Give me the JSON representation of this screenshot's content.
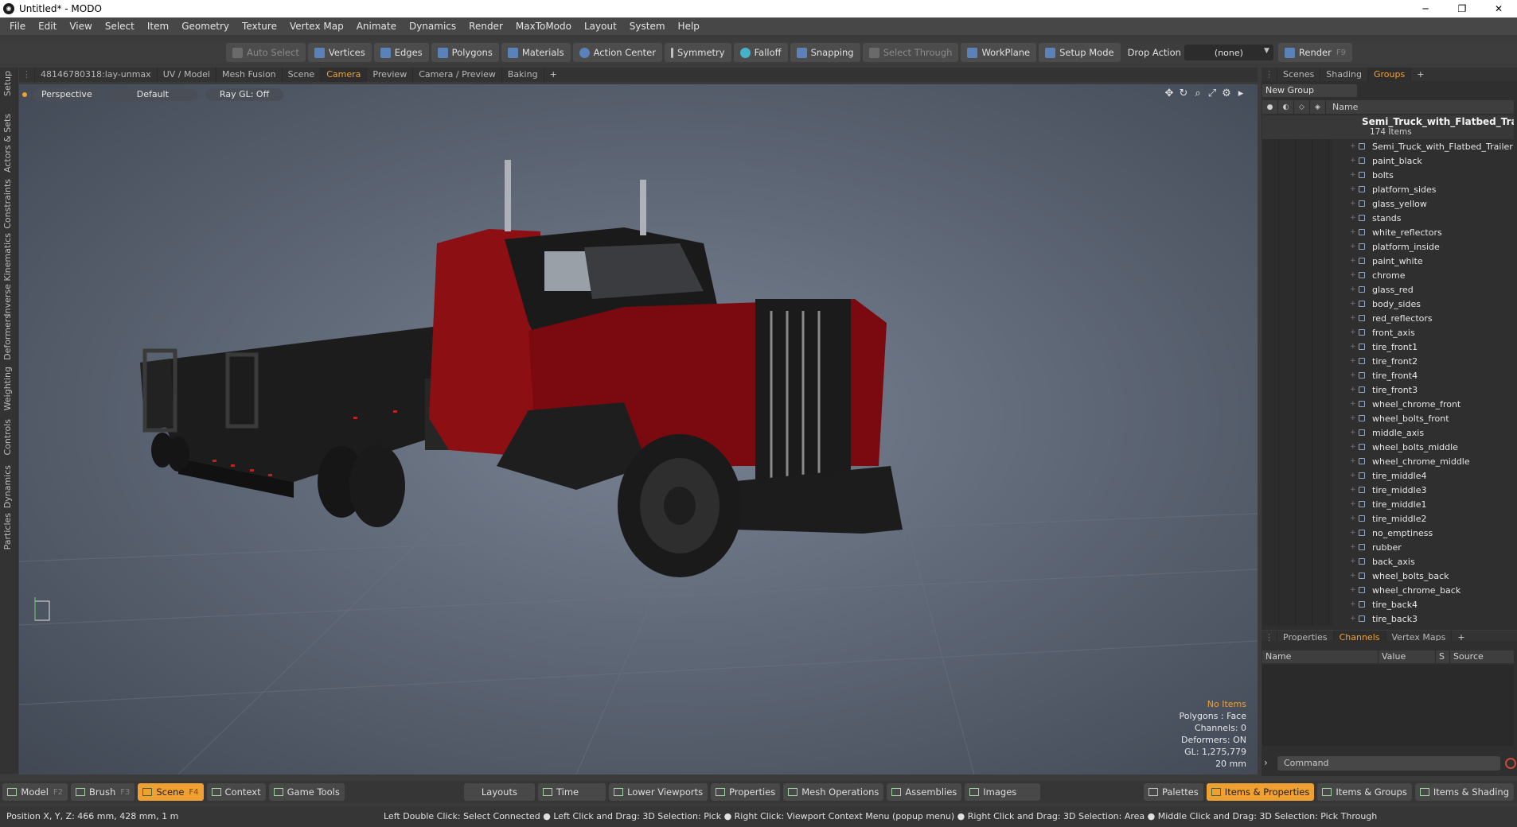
{
  "app": {
    "window_title": "Untitled* - MODO",
    "window_controls": [
      "─",
      "❐",
      "✕"
    ]
  },
  "menu": [
    "File",
    "Edit",
    "View",
    "Select",
    "Item",
    "Geometry",
    "Texture",
    "Vertex Map",
    "Animate",
    "Dynamics",
    "Render",
    "MaxToModo",
    "Layout",
    "System",
    "Help"
  ],
  "toolbar": {
    "auto_select": "Auto Select",
    "vertices": "Vertices",
    "edges": "Edges",
    "polygons": "Polygons",
    "materials": "Materials",
    "action_center": "Action Center",
    "symmetry": "Symmetry",
    "falloff": "Falloff",
    "snapping": "Snapping",
    "select_through": "Select Through",
    "workplane": "WorkPlane",
    "setup_mode": "Setup Mode",
    "drop_action_label": "Drop Action",
    "drop_action_value": "(none)",
    "render": "Render",
    "render_key": "F9"
  },
  "viewport_tabs": [
    "48146780318:lay-unmax",
    "UV / Model",
    "Mesh Fusion",
    "Scene",
    "Camera",
    "Preview",
    "Camera / Preview",
    "Baking",
    "+"
  ],
  "viewport_tabs_active": "Camera",
  "left_tabs": [
    "Setup",
    "Actors & Sets",
    "Constraints",
    "Inverse Kinematics",
    "Deformers",
    "Weighting",
    "Controls",
    "Dynamics",
    "Particles"
  ],
  "viewport": {
    "options": [
      "Perspective",
      "Default",
      "Ray GL: Off"
    ],
    "info": {
      "items": "No Items",
      "polygons": "Polygons : Face",
      "channels": "Channels: 0",
      "deformers": "Deformers: ON",
      "gl": "GL: 1,275,779",
      "scale": "20 mm"
    }
  },
  "right_tabs": [
    "Scenes",
    "Shading",
    "Groups",
    "+"
  ],
  "right_tabs_active": "Groups",
  "groups": {
    "new_group": "New Group",
    "column_name": "Name",
    "group_name": "Semi_Truck_with_Flatbed_Tra...",
    "group_count": "174 Items",
    "items": [
      "Semi_Truck_with_Flatbed_Trailer",
      "paint_black",
      "bolts",
      "platform_sides",
      "glass_yellow",
      "stands",
      "white_reflectors",
      "platform_inside",
      "paint_white",
      "chrome",
      "glass_red",
      "body_sides",
      "red_reflectors",
      "front_axis",
      "tire_front1",
      "tire_front2",
      "tire_front4",
      "tire_front3",
      "wheel_chrome_front",
      "wheel_bolts_front",
      "middle_axis",
      "wheel_bolts_middle",
      "wheel_chrome_middle",
      "tire_middle4",
      "tire_middle3",
      "tire_middle1",
      "tire_middle2",
      "no_emptiness",
      "rubber",
      "back_axis",
      "wheel_bolts_back",
      "wheel_chrome_back",
      "tire_back4",
      "tire_back3"
    ]
  },
  "props_tabs": [
    "Properties",
    "Channels",
    "Vertex Maps",
    "+"
  ],
  "props_tabs_active": "Channels",
  "channels": {
    "name": "Name",
    "value": "Value",
    "s": "S",
    "source": "Source"
  },
  "command_placeholder": "Command",
  "bottom_left": [
    {
      "label": "Model",
      "key": "F2"
    },
    {
      "label": "Brush",
      "key": "F3"
    },
    {
      "label": "Scene",
      "key": "F4"
    },
    {
      "label": "Context",
      "key": ""
    },
    {
      "label": "Game Tools",
      "key": ""
    }
  ],
  "bottom_center": [
    "Layouts",
    "Time",
    "Lower Viewports",
    "Properties",
    "Mesh Operations",
    "Assemblies",
    "Images"
  ],
  "bottom_right": [
    "Palettes",
    "Items & Properties",
    "Items & Groups",
    "Items & Shading"
  ],
  "status": {
    "position": "Position X, Y, Z:   466 mm, 428 mm, 1 m",
    "hint": "Left Double Click: Select Connected ● Left Click and Drag: 3D Selection: Pick ● Right Click: Viewport Context Menu (popup menu) ● Right Click and Drag: 3D Selection: Area ● Middle Click and Drag: 3D Selection: Pick Through"
  },
  "colors": {
    "accent": "#f0a030",
    "viewport_bg": "#5f6877",
    "truck_red": "#8c0f14"
  }
}
